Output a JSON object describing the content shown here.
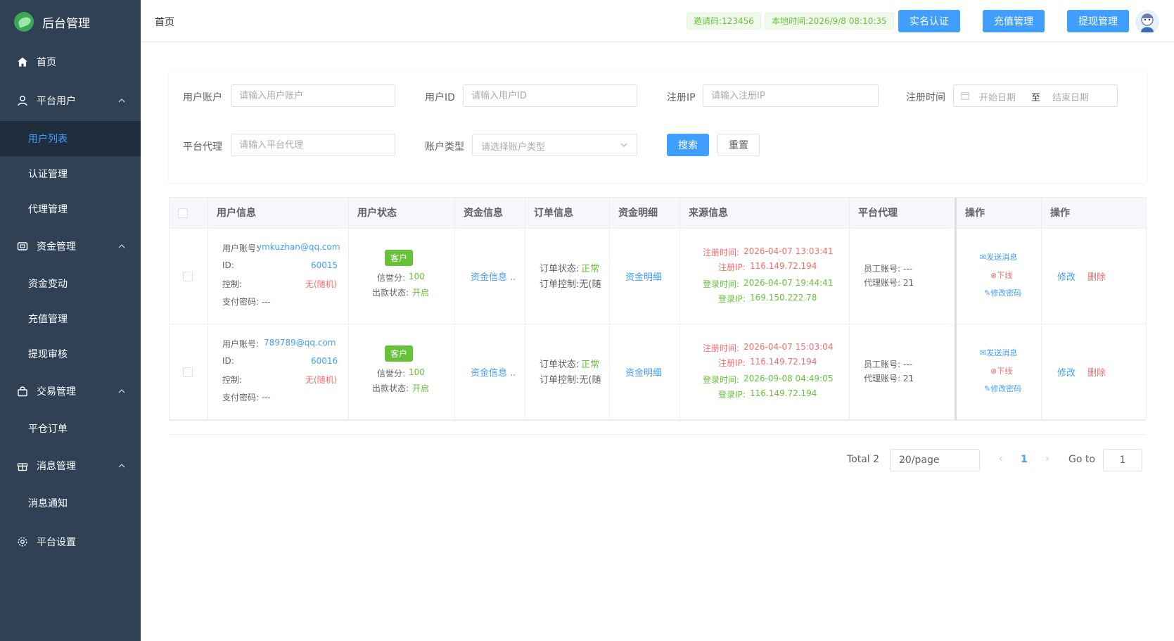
{
  "app": {
    "title": "后台管理"
  },
  "sidebar": {
    "home": "首页",
    "groups": [
      {
        "label": "平台用户",
        "items": [
          "用户列表",
          "认证管理",
          "代理管理"
        ]
      },
      {
        "label": "资金管理",
        "items": [
          "资金变动",
          "充值管理",
          "提现审核"
        ]
      },
      {
        "label": "交易管理",
        "items": [
          "平仓订单"
        ]
      },
      {
        "label": "消息管理",
        "items": [
          "消息通知"
        ]
      }
    ],
    "settings": "平台设置",
    "active_item": "用户列表"
  },
  "header": {
    "breadcrumb": "首页",
    "invite_code": "邀请码:123456",
    "local_time": "本地时间:2026/9/8 08:10:35",
    "buttons": [
      "实名认证",
      "充值管理",
      "提现管理"
    ]
  },
  "filters": {
    "account": {
      "label": "用户账户",
      "placeholder": "请输入用户账户"
    },
    "user_id": {
      "label": "用户ID",
      "placeholder": "请输入用户ID"
    },
    "reg_ip": {
      "label": "注册IP",
      "placeholder": "请输入注册IP"
    },
    "reg_time": {
      "label": "注册时间",
      "start_placeholder": "开始日期",
      "separator": "至",
      "end_placeholder": "结束日期"
    },
    "agent": {
      "label": "平台代理",
      "placeholder": "请输入平台代理"
    },
    "account_type": {
      "label": "账户类型",
      "placeholder": "请选择账户类型"
    },
    "search_label": "搜索",
    "reset_label": "重置"
  },
  "table": {
    "headers": [
      "用户信息",
      "用户状态",
      "资金信息",
      "订单信息",
      "资金明细",
      "来源信息",
      "平台代理",
      "操作",
      "操作"
    ],
    "labels": {
      "account": "用户账号:",
      "id": "ID:",
      "control": "控制:",
      "pay_pwd": "支付密码: ---",
      "credit": "信誉分:",
      "withdraw_status": "出款状态:",
      "order_status": "订单状态:",
      "order_control": "订单控制:无(随",
      "reg_time": "注册时间:",
      "reg_ip": "注册IP:",
      "login_time": "登录时间:",
      "login_ip": "登录IP:",
      "staff": "员工账号: ---",
      "agent": "代理账号: 21",
      "send_msg": "发送消息",
      "offline": "下线",
      "change_pwd": "修改密码",
      "edit": "修改",
      "delete": "删除",
      "fund_info": "资金信息 ..",
      "fund_detail": "资金明细"
    },
    "rows": [
      {
        "account": "ymkuzhan@qq.com",
        "id": "60015",
        "control": "无(随机)",
        "tag": "客户",
        "credit": "100",
        "withdraw": "开启",
        "order_status": "正常",
        "reg_time": "2026-04-07 13:03:41",
        "reg_ip": "116.149.72.194",
        "login_time": "2026-04-07 19:44:41",
        "login_ip": "169.150.222.78"
      },
      {
        "account": "789789@qq.com",
        "id": "60016",
        "control": "无(随机)",
        "tag": "客户",
        "credit": "100",
        "withdraw": "开启",
        "order_status": "正常",
        "reg_time": "2026-04-07 15:03:04",
        "reg_ip": "116.149.72.194",
        "login_time": "2026-09-08 04:49:05",
        "login_ip": "116.149.72.194"
      }
    ]
  },
  "pagination": {
    "total": "Total 2",
    "page_size": "20/page",
    "current": "1",
    "goto_label": "Go to",
    "goto_value": "1"
  },
  "colors": {
    "primary": "#409eff",
    "sidebar": "#304156",
    "success": "#67c23a",
    "danger": "#f56c6c"
  }
}
